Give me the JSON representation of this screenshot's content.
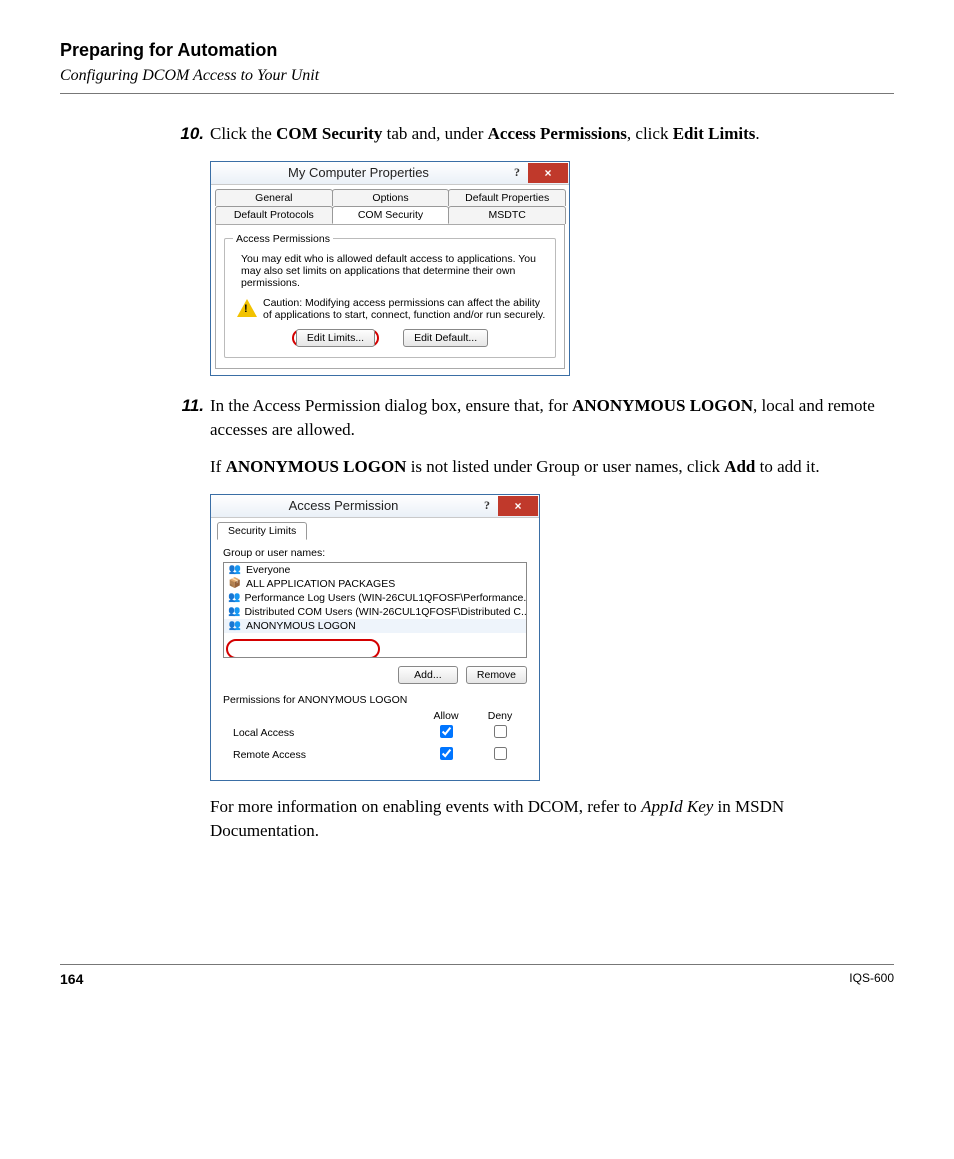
{
  "page": {
    "title": "Preparing for Automation",
    "subtitle": "Configuring DCOM Access to Your Unit",
    "number": "164",
    "model": "IQS-600"
  },
  "steps": {
    "s10": {
      "num": "10.",
      "click_the": "Click the ",
      "com_security": "COM Security",
      "mid1": " tab and, under ",
      "access_permissions": "Access Permissions",
      "mid2": ", click ",
      "edit_limits": "Edit Limits",
      "end": "."
    },
    "s11": {
      "num": "11.",
      "p1a": "In the Access Permission dialog box, ensure that, for ",
      "anon": "ANONYMOUS LOGON",
      "p1b": ", local and remote accesses are allowed.",
      "p2a": "If ",
      "p2b": " is not listed under Group or user names, click ",
      "add": "Add",
      "p2c": " to add it."
    },
    "closing": {
      "a": "For more information on enabling events with DCOM, refer to ",
      "appid": "AppId Key",
      "b": " in MSDN Documentation."
    }
  },
  "dialog1": {
    "title": "My Computer Properties",
    "help": "?",
    "close": "×",
    "tabs_row1": [
      "General",
      "Options",
      "Default Properties"
    ],
    "tabs_row2": [
      "Default Protocols",
      "COM Security",
      "MSDTC"
    ],
    "group_legend": "Access Permissions",
    "desc": "You may edit who is allowed default access to applications. You may also set limits on applications that determine their own permissions.",
    "caution": "Caution: Modifying access permissions can affect the ability of applications to start, connect, function and/or run securely.",
    "btn_edit_limits": "Edit Limits...",
    "btn_edit_default": "Edit Default..."
  },
  "dialog2": {
    "title": "Access Permission",
    "help": "?",
    "close": "×",
    "tab": "Security Limits",
    "group_label": "Group or user names:",
    "items": [
      "Everyone",
      "ALL APPLICATION PACKAGES",
      "Performance Log Users (WIN-26CUL1QFOSF\\Performance...",
      "Distributed COM Users (WIN-26CUL1QFOSF\\Distributed C...",
      "ANONYMOUS LOGON"
    ],
    "btn_add": "Add...",
    "btn_remove": "Remove",
    "perm_label": "Permissions for ANONYMOUS LOGON",
    "col_allow": "Allow",
    "col_deny": "Deny",
    "rows": [
      {
        "name": "Local Access",
        "allow": true,
        "deny": false
      },
      {
        "name": "Remote Access",
        "allow": true,
        "deny": false
      }
    ]
  }
}
